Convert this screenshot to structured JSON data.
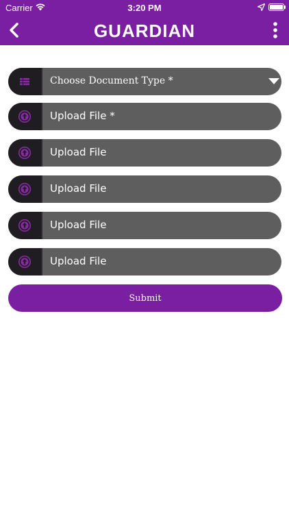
{
  "status_bar": {
    "carrier": "Carrier",
    "time": "3:20 PM"
  },
  "header": {
    "title": "GUARDIAN",
    "back_icon": "chevron-left-icon",
    "menu_icon": "more-vertical-icon"
  },
  "form": {
    "document_type": {
      "label": "Choose Document Type *",
      "icon": "grid-list-icon"
    },
    "uploads": [
      {
        "label": "Upload File *",
        "icon": "upload-circle-icon"
      },
      {
        "label": "Upload File",
        "icon": "upload-circle-icon"
      },
      {
        "label": "Upload File",
        "icon": "upload-circle-icon"
      },
      {
        "label": "Upload File",
        "icon": "upload-circle-icon"
      },
      {
        "label": "Upload File",
        "icon": "upload-circle-icon"
      }
    ],
    "submit_label": "Submit"
  },
  "colors": {
    "brand": "#7a1fa2",
    "field_bg": "#5e5e5e",
    "icon_cell_bg": "#1f1c22",
    "icon_accent": "#8a2aa6"
  }
}
